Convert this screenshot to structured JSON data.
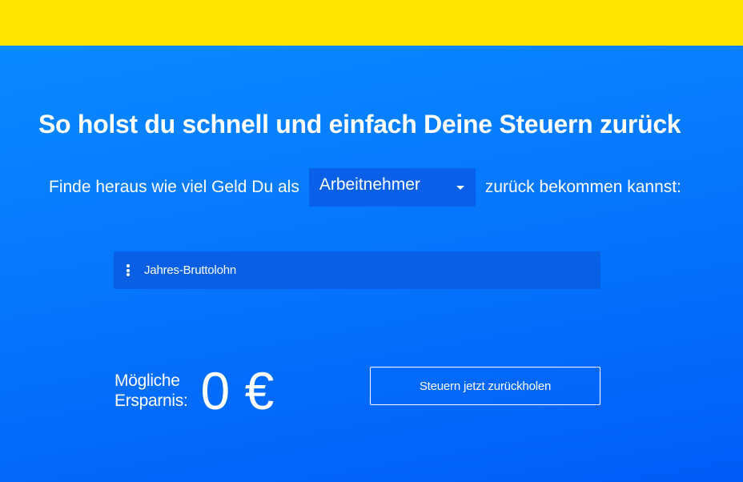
{
  "headline": "So holst du schnell und einfach Deine Steuern zurück",
  "lead": {
    "prefix": "Finde heraus wie viel Geld Du als",
    "suffix": "zurück bekommen kannst:"
  },
  "employment_select": {
    "selected": "Arbeitnehmer",
    "icon": "caret-down-icon"
  },
  "salary_field": {
    "placeholder": "Jahres-Bruttolohn",
    "icon": "kebab-menu-icon"
  },
  "savings": {
    "label_line1": "Mögliche",
    "label_line2": "Ersparnis:",
    "amount": "0 €"
  },
  "cta": {
    "label": "Steuern jetzt zurückholen"
  },
  "colors": {
    "top_bar": "#ffe400",
    "hero_top": "#0a8bff",
    "hero_bottom": "#005cf7",
    "field_bg": "#085fe4",
    "text": "#ffffff"
  }
}
